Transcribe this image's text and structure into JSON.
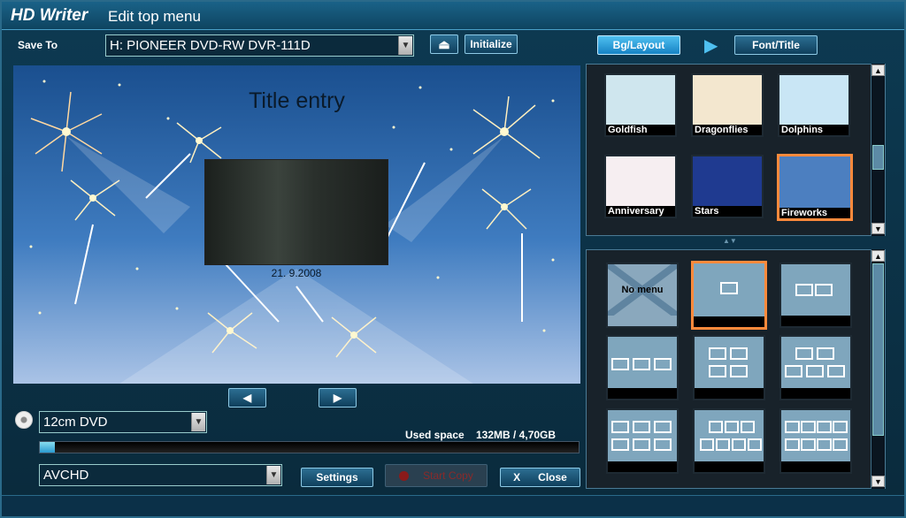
{
  "window": {
    "brand": "HD Writer",
    "title": "Edit top menu"
  },
  "save_to": {
    "label": "Save To",
    "drive": "H: PIONEER DVD-RW  DVR-111D",
    "eject_icon": "eject-icon",
    "initialize_label": "Initialize"
  },
  "tabs": {
    "bg_layout": "Bg/Layout",
    "font_title": "Font/Title"
  },
  "preview": {
    "title": "Title entry",
    "thumb_date": "21. 9.2008"
  },
  "backgrounds": [
    {
      "label": "Goldfish",
      "color": "#cfe6ee"
    },
    {
      "label": "Dragonflies",
      "color": "#f3e7cf"
    },
    {
      "label": "Dolphins",
      "color": "#c9e6f5"
    },
    {
      "label": "Anniversary",
      "color": "#f6eef1"
    },
    {
      "label": "Stars",
      "color": "#1f3a90"
    },
    {
      "label": "Fireworks",
      "color": "#4c7fc0"
    }
  ],
  "selected_background": "Fireworks",
  "layouts": {
    "no_menu_label": "No menu"
  },
  "disc": {
    "type": "12cm DVD",
    "used_space_label": "Used space",
    "used_space_value": "132MB / 4,70GB",
    "used_fraction": 0.028
  },
  "format": {
    "value": "AVCHD"
  },
  "buttons": {
    "settings": "Settings",
    "start_copy": "Start Copy",
    "close_x": "X",
    "close": "Close"
  },
  "colors": {
    "accent": "#ff8a3c",
    "tab_active": "#39b0ea"
  }
}
